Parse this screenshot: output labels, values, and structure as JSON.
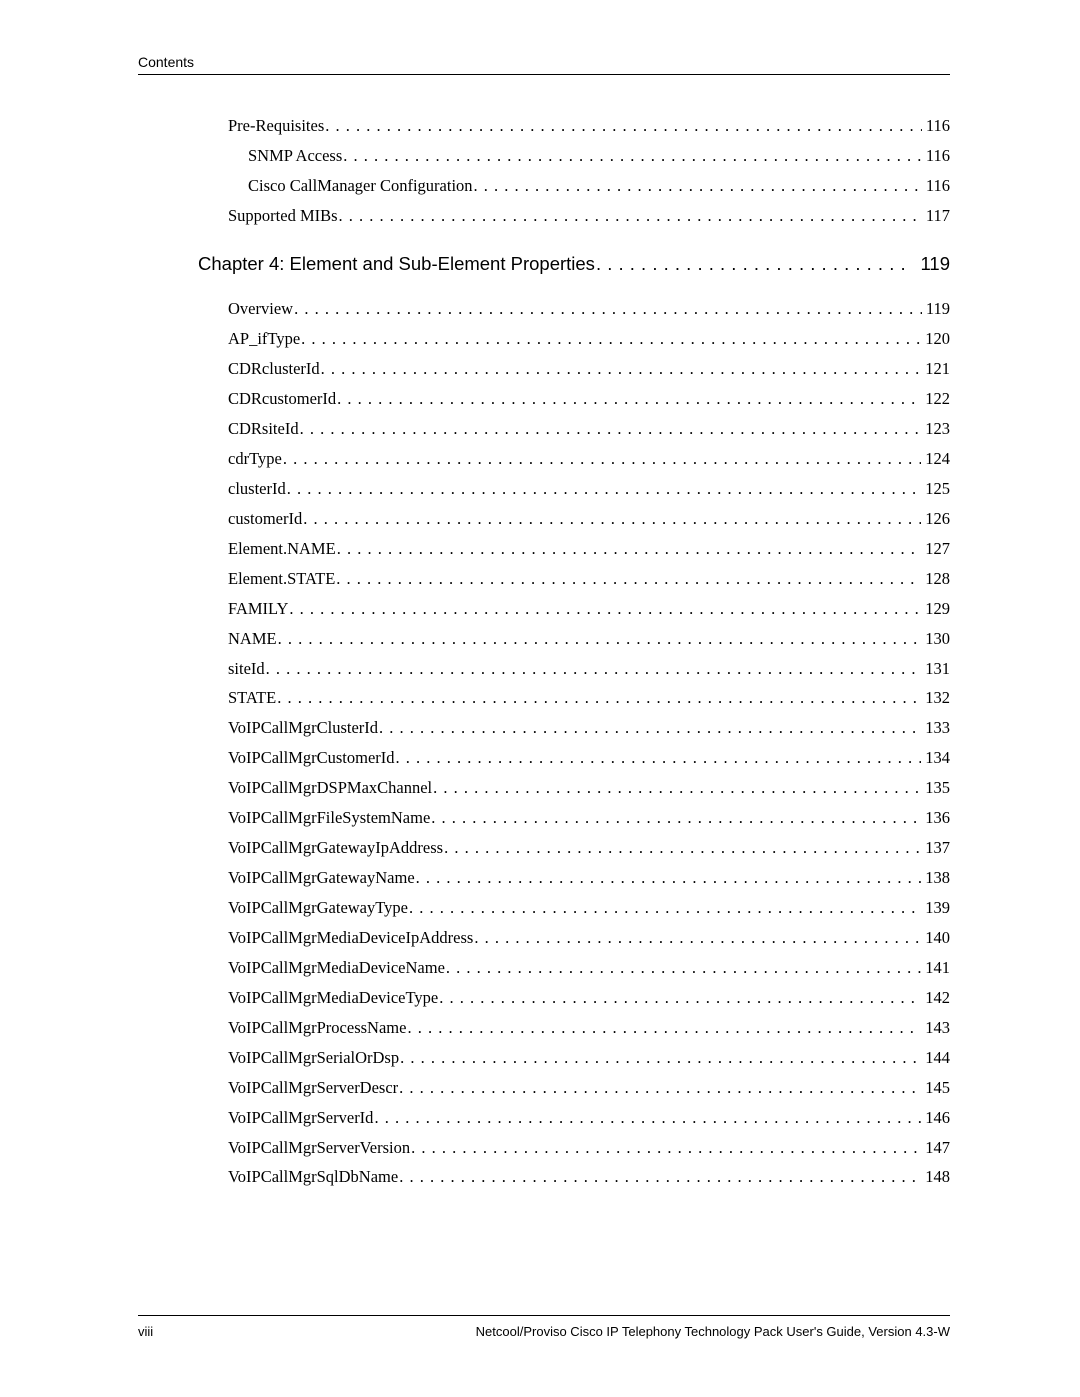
{
  "header": {
    "label": "Contents"
  },
  "pre_section": [
    {
      "title": "Pre-Requisites",
      "page": "116",
      "level": 1
    },
    {
      "title": "SNMP Access",
      "page": "116",
      "level": 2
    },
    {
      "title": "Cisco CallManager Configuration",
      "page": "116",
      "level": 2
    },
    {
      "title": "Supported MIBs",
      "page": "117",
      "level": 1
    }
  ],
  "chapter": {
    "title": "Chapter 4: Element and Sub-Element Properties",
    "page": "119"
  },
  "chapter_items": [
    {
      "title": "Overview",
      "page": "119"
    },
    {
      "title": "AP_ifType",
      "page": "120"
    },
    {
      "title": "CDRclusterId",
      "page": "121"
    },
    {
      "title": "CDRcustomerId",
      "page": "122"
    },
    {
      "title": "CDRsiteId",
      "page": "123"
    },
    {
      "title": "cdrType",
      "page": "124"
    },
    {
      "title": "clusterId",
      "page": "125"
    },
    {
      "title": "customerId",
      "page": "126"
    },
    {
      "title": "Element.NAME",
      "page": "127"
    },
    {
      "title": "Element.STATE",
      "page": "128"
    },
    {
      "title": "FAMILY",
      "page": "129"
    },
    {
      "title": "NAME",
      "page": "130"
    },
    {
      "title": "siteId",
      "page": "131"
    },
    {
      "title": "STATE",
      "page": "132"
    },
    {
      "title": "VoIPCallMgrClusterId",
      "page": "133"
    },
    {
      "title": "VoIPCallMgrCustomerId",
      "page": "134"
    },
    {
      "title": "VoIPCallMgrDSPMaxChannel",
      "page": "135"
    },
    {
      "title": "VoIPCallMgrFileSystemName",
      "page": "136"
    },
    {
      "title": "VoIPCallMgrGatewayIpAddress",
      "page": "137"
    },
    {
      "title": "VoIPCallMgrGatewayName",
      "page": "138"
    },
    {
      "title": "VoIPCallMgrGatewayType",
      "page": "139"
    },
    {
      "title": "VoIPCallMgrMediaDeviceIpAddress",
      "page": "140"
    },
    {
      "title": "VoIPCallMgrMediaDeviceName",
      "page": "141"
    },
    {
      "title": "VoIPCallMgrMediaDeviceType",
      "page": "142"
    },
    {
      "title": "VoIPCallMgrProcessName",
      "page": "143"
    },
    {
      "title": "VoIPCallMgrSerialOrDsp",
      "page": "144"
    },
    {
      "title": "VoIPCallMgrServerDescr",
      "page": "145"
    },
    {
      "title": "VoIPCallMgrServerId",
      "page": "146"
    },
    {
      "title": "VoIPCallMgrServerVersion",
      "page": "147"
    },
    {
      "title": "VoIPCallMgrSqlDbName",
      "page": "148"
    }
  ],
  "footer": {
    "page_number": "viii",
    "doc_title": "Netcool/Proviso Cisco IP Telephony Technology Pack User's Guide, Version 4.3-W"
  }
}
